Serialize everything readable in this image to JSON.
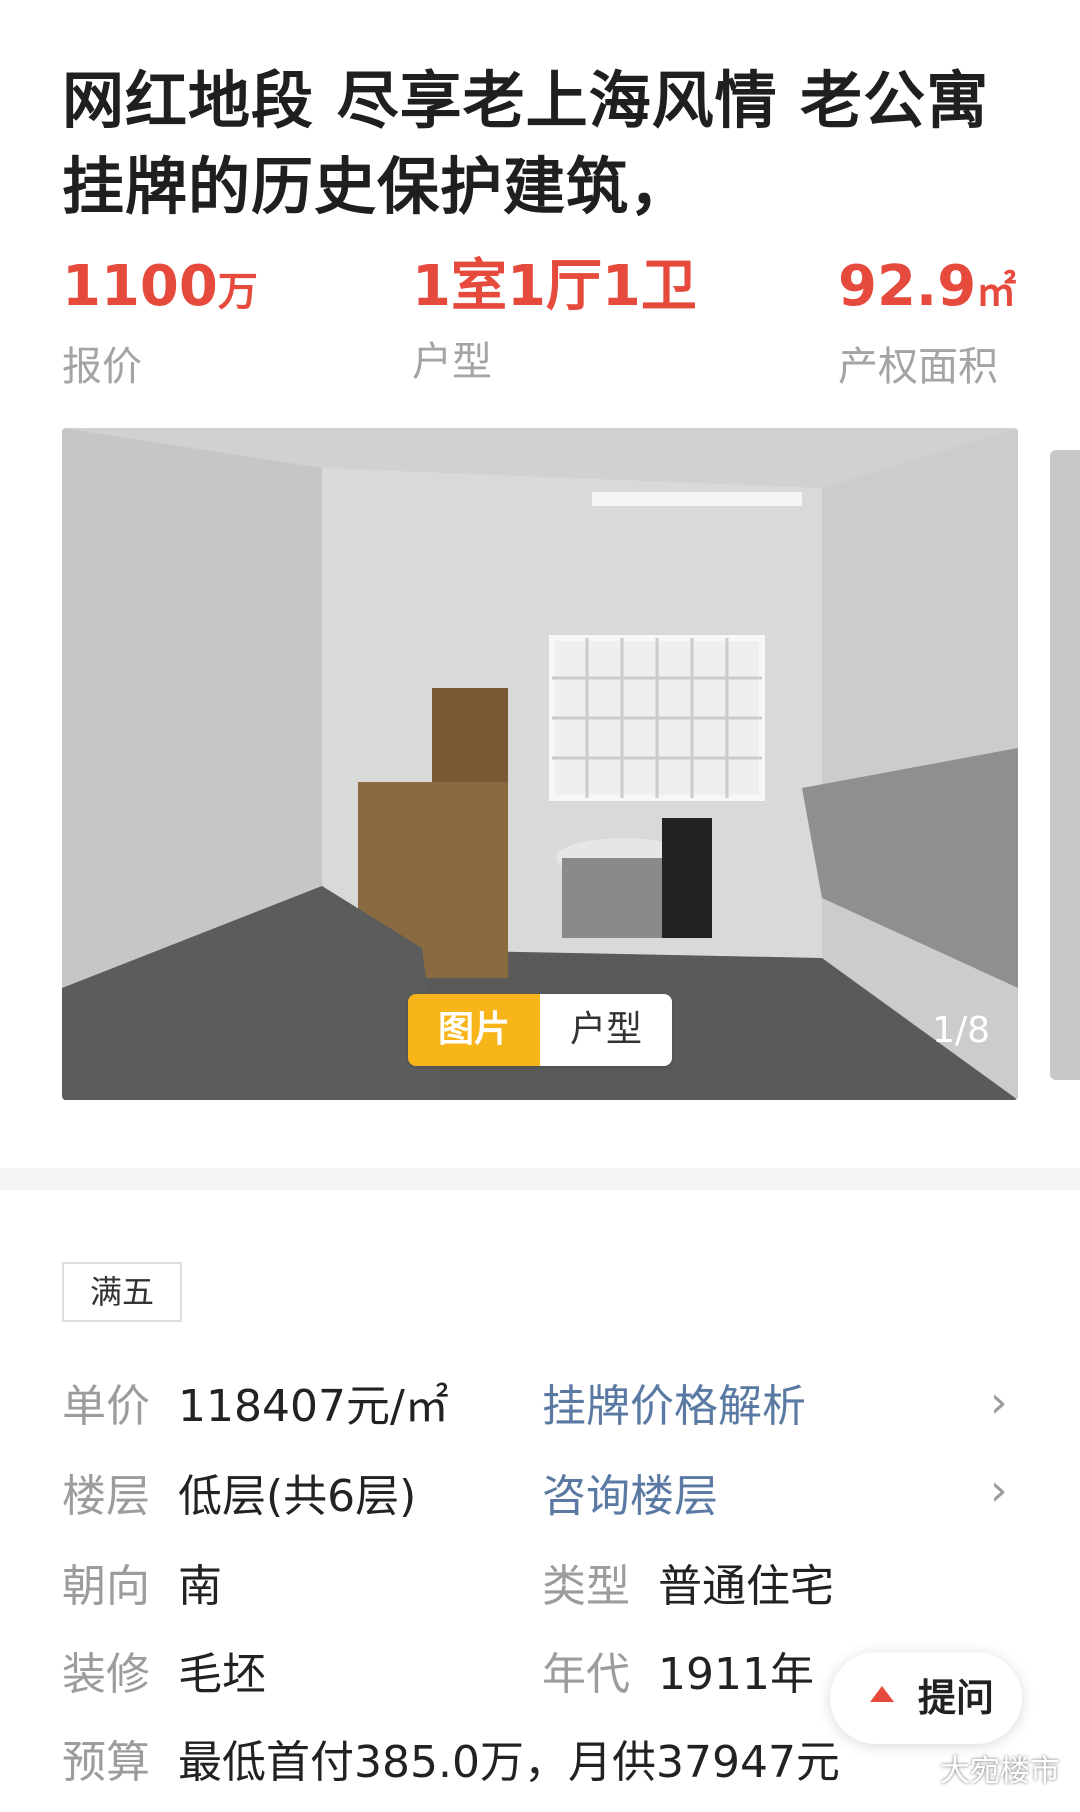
{
  "listing": {
    "title": "网红地段 尽享老上海风情 老公寓挂牌的历史保护建筑，",
    "price": {
      "value": "1100",
      "unit": "万",
      "label": "报价"
    },
    "layout": {
      "value": "1室1厅1卫",
      "label": "户型"
    },
    "area": {
      "value": "92.9",
      "unit": "㎡",
      "label": "产权面积"
    }
  },
  "gallery": {
    "tabs": [
      {
        "label": "图片",
        "active": true
      },
      {
        "label": "户型",
        "active": false
      }
    ],
    "counter": "1/8"
  },
  "tag": "满五",
  "details": {
    "unit_price": {
      "key": "单价",
      "value": "118407元/㎡",
      "link": "挂牌价格解析"
    },
    "floor": {
      "key": "楼层",
      "value": "低层(共6层)",
      "link": "咨询楼层"
    },
    "orientation": {
      "key": "朝向",
      "value": "南"
    },
    "type": {
      "key": "类型",
      "value": "普通住宅"
    },
    "decoration": {
      "key": "装修",
      "value": "毛坯"
    },
    "year": {
      "key": "年代",
      "value": "1911年"
    },
    "budget": {
      "key": "预算",
      "value": "最低首付385.0万，月供37947元"
    }
  },
  "ask_button": "提问",
  "watermark": "大宛楼市",
  "colors": {
    "accent": "#e64a3c",
    "tab_active": "#f7b519",
    "link": "#5a7aa3"
  }
}
